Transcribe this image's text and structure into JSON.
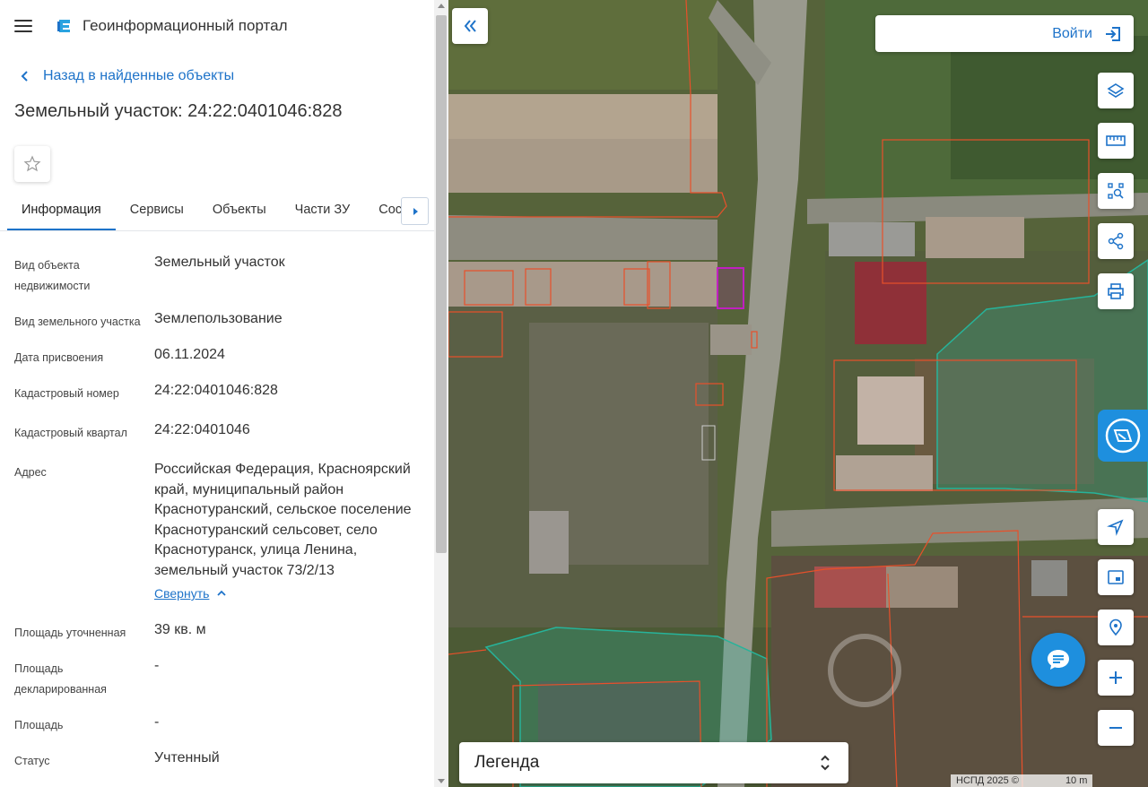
{
  "header": {
    "app_title": "Геоинформационный портал"
  },
  "nav": {
    "back_label": "Назад в найденные объекты"
  },
  "object": {
    "title": "Земельный участок: 24:22:0401046:828"
  },
  "tabs": [
    {
      "label": "Информация",
      "active": true
    },
    {
      "label": "Сервисы"
    },
    {
      "label": "Объекты"
    },
    {
      "label": "Части ЗУ"
    },
    {
      "label": "Соста…"
    }
  ],
  "info": {
    "rows": [
      {
        "label": "Вид объекта недвижимости",
        "value": "Земельный участок"
      },
      {
        "label": "Вид земельного участка",
        "value": "Землепользование"
      },
      {
        "label": "Дата присвоения",
        "value": "06.11.2024"
      },
      {
        "label": "Кадастровый номер",
        "value": "24:22:0401046:828"
      },
      {
        "label": "Кадастровый квартал",
        "value": "24:22:0401046"
      },
      {
        "label": "Адрес",
        "value": "Российская Федерация, Красноярский край, муниципальный район Краснотуранский, сельское поселение Краснотуранский сельсовет, село Краснотуранск, улица Ленина, земельный участок 73/2/13"
      },
      {
        "label": "Площадь уточненная",
        "value": "39 кв. м"
      },
      {
        "label": "Площадь декларированная",
        "value": "-"
      },
      {
        "label": "Площадь",
        "value": "-"
      },
      {
        "label": "Статус",
        "value": "Учтенный"
      }
    ],
    "collapse_label": "Свернуть"
  },
  "map": {
    "login_label": "Войти",
    "legend_label": "Легенда",
    "copyright": "НСПД 2025 ©",
    "scale": "10 m",
    "tools": [
      "layers-icon",
      "ruler-icon",
      "select-area-icon",
      "share-icon",
      "print-icon",
      "locate-icon",
      "minimap-icon",
      "geo-search-icon",
      "zoom-in-icon",
      "zoom-out-icon"
    ]
  },
  "colors": {
    "accent": "#1e73c9",
    "parcel_border": "#e8502a",
    "selected_parcel": "#c020c0",
    "zone": "#27b39a"
  }
}
